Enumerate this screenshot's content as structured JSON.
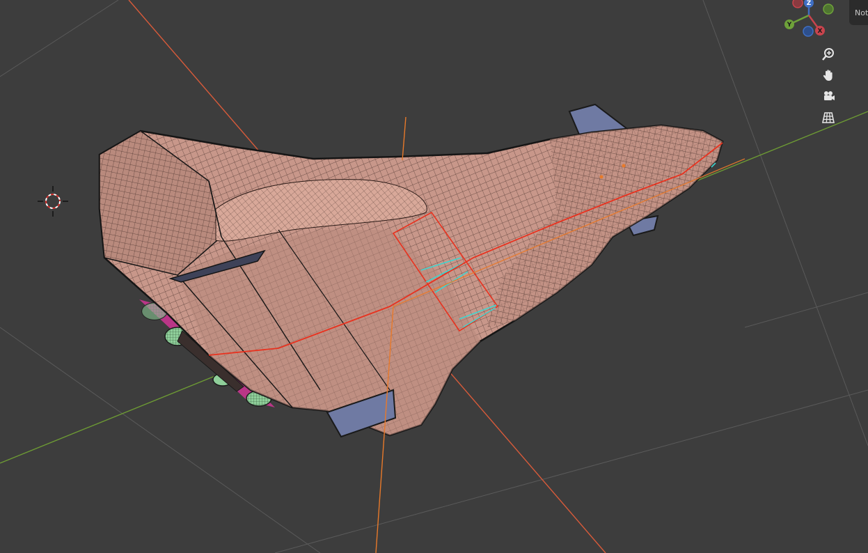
{
  "viewport": {
    "background": "#3d3d3d",
    "mesh_color": "#c8978a",
    "wire_color": "#2a1a16",
    "seam_color": "#e8321f",
    "x_axis_color": "#d95b3a",
    "y_axis_color": "#6d9a34",
    "fin_color": "#6f7aa3",
    "thruster_color": "#8fcf9a",
    "accent_magenta": "#c7358f",
    "accent_cyan": "#3fd6d0"
  },
  "gizmo": {
    "z_label": "Z",
    "y_label": "Y",
    "x_label": "X",
    "x_color": "#c9444d",
    "y_color": "#6ea13a",
    "z_color": "#3f6fc4"
  },
  "nav_buttons": [
    {
      "icon": "zoom-icon"
    },
    {
      "icon": "hand-pan-icon"
    },
    {
      "icon": "camera-icon"
    },
    {
      "icon": "perspective-grid-icon"
    }
  ],
  "n_panel_tab": {
    "label": "Not"
  }
}
